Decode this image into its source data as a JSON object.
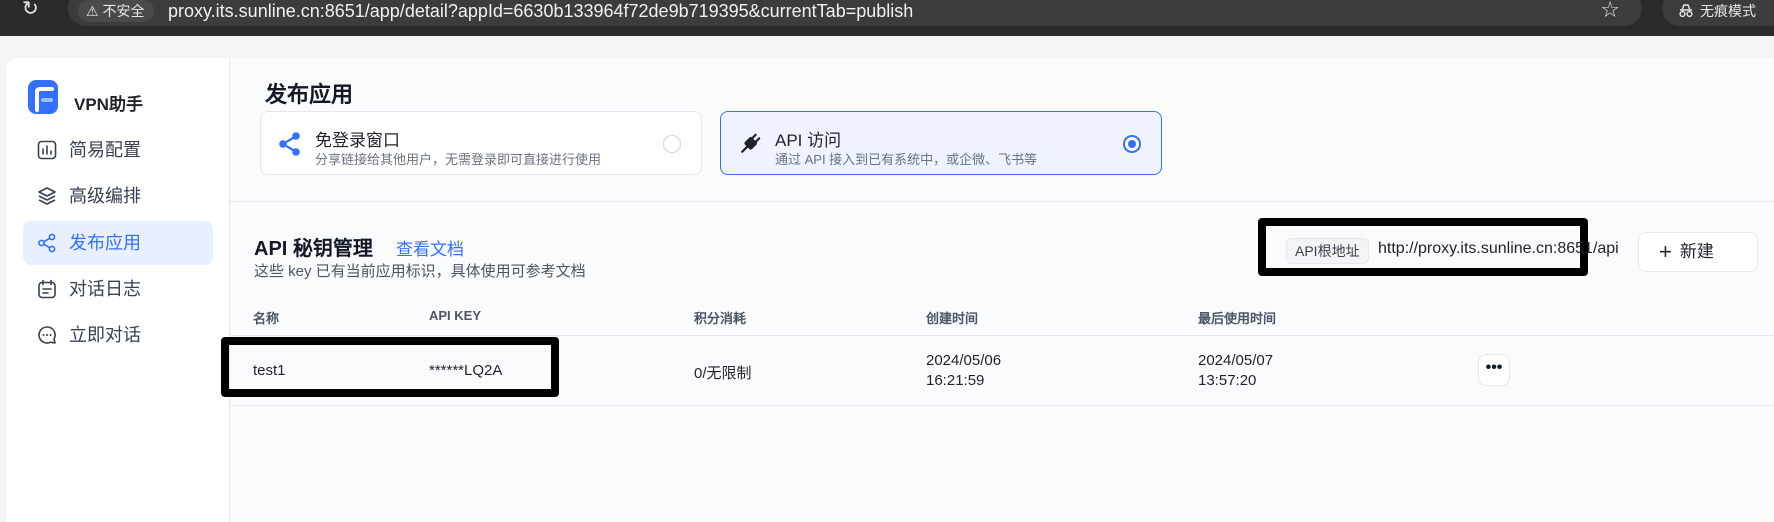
{
  "browser": {
    "security_label": "不安全",
    "url": "proxy.its.sunline.cn:8651/app/detail?appId=6630b133964f72de9b719395&currentTab=publish",
    "incognito_label": "无痕模式"
  },
  "sidebar": {
    "app_name": "VPN助手",
    "items": [
      {
        "label": "简易配置",
        "icon": "bar-chart-icon"
      },
      {
        "label": "高级编排",
        "icon": "layers-icon"
      },
      {
        "label": "发布应用",
        "icon": "share-icon",
        "active": true
      },
      {
        "label": "对话日志",
        "icon": "calendar-icon"
      },
      {
        "label": "立即对话",
        "icon": "chat-icon"
      }
    ]
  },
  "publish": {
    "title": "发布应用",
    "options": [
      {
        "title": "免登录窗口",
        "desc": "分享链接给其他用户，无需登录即可直接进行使用",
        "selected": false
      },
      {
        "title": "API 访问",
        "desc": "通过 API 接入到已有系统中，或企微、飞书等",
        "selected": true
      }
    ]
  },
  "api_keys": {
    "title": "API 秘钥管理",
    "doc_link": "查看文档",
    "subtitle": "这些 key 已有当前应用标识，具体使用可参考文档",
    "base_url_label": "API根地址",
    "base_url": "http://proxy.its.sunline.cn:8651/api",
    "new_button": "新建",
    "columns": [
      "名称",
      "API KEY",
      "积分消耗",
      "创建时间",
      "最后使用时间"
    ],
    "rows": [
      {
        "name": "test1",
        "key": "******LQ2A",
        "usage": "0/无限制",
        "created_date": "2024/05/06",
        "created_time": "16:21:59",
        "last_date": "2024/05/07",
        "last_time": "13:57:20",
        "more": "•••"
      }
    ]
  },
  "colors": {
    "accent": "#3370ff",
    "annotation": "#000000"
  }
}
